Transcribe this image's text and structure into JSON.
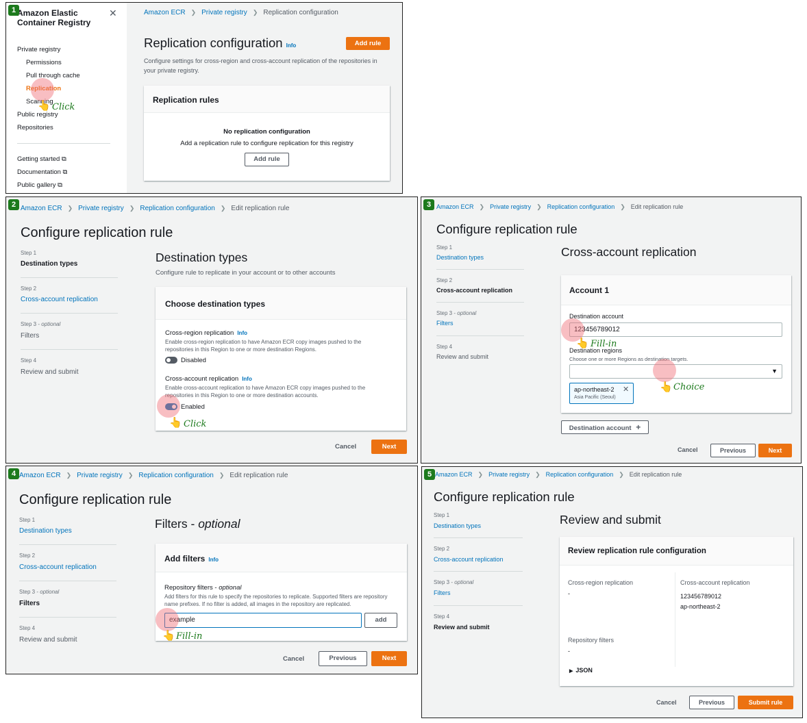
{
  "step_numbers": [
    "1",
    "2",
    "3",
    "4",
    "5"
  ],
  "actions": {
    "click": "Click",
    "fill_in": "Fill-in",
    "choice": "Choice"
  },
  "p1": {
    "sidebar_title": "Amazon Elastic Container Registry",
    "close_icon": "close-icon",
    "nav": {
      "private_registry": "Private registry",
      "permissions": "Permissions",
      "pull_through_cache": "Pull through cache",
      "replication": "Replication",
      "scanning": "Scanning",
      "public_registry": "Public registry",
      "repositories": "Repositories",
      "getting_started": "Getting started",
      "documentation": "Documentation",
      "public_gallery": "Public gallery"
    },
    "crumbs": [
      "Amazon ECR",
      "Private registry",
      "Replication configuration"
    ],
    "title": "Replication configuration",
    "info": "Info",
    "add_rule_btn": "Add rule",
    "description": "Configure settings for cross-region and cross-account replication of the repositories in your private registry.",
    "card_title": "Replication rules",
    "empty_title": "No replication configuration",
    "empty_desc": "Add a replication rule to configure replication for this registry",
    "empty_btn": "Add rule"
  },
  "wizard": {
    "crumbs": [
      "Amazon ECR",
      "Private registry",
      "Replication configuration",
      "Edit replication rule"
    ],
    "title": "Configure replication rule",
    "steps": [
      {
        "label": "Step 1",
        "name": "Destination types"
      },
      {
        "label": "Step 2",
        "name": "Cross-account replication"
      },
      {
        "label": "Step 3",
        "optional": "optional",
        "name": "Filters"
      },
      {
        "label": "Step 4",
        "name": "Review and submit"
      }
    ],
    "cancel": "Cancel",
    "previous": "Previous",
    "next": "Next",
    "submit": "Submit rule"
  },
  "p2": {
    "section_title": "Destination types",
    "section_desc": "Configure rule to replicate in your account or to other accounts",
    "card_title": "Choose destination types",
    "cross_region": {
      "label": "Cross-region replication",
      "info": "Info",
      "desc": "Enable cross-region replication to have Amazon ECR copy images pushed to the repositories in this Region to one or more destination Regions.",
      "state": "Disabled"
    },
    "cross_account": {
      "label": "Cross-account replication",
      "info": "Info",
      "desc": "Enable cross-account replication to have Amazon ECR copy images pushed to the repositories in this Region to one or more destination accounts.",
      "state": "Enabled"
    }
  },
  "p3": {
    "section_title": "Cross-account replication",
    "card_title": "Account 1",
    "dest_account_label": "Destination account",
    "dest_account_value": "123456789012",
    "dest_regions_label": "Destination regions",
    "dest_regions_desc": "Choose one or more Regions as destination targets.",
    "token_region": "ap-northeast-2",
    "token_sub": "Asia Pacific (Seoul)",
    "add_dest_btn": "Destination account"
  },
  "p4": {
    "section_title": "Filters - ",
    "section_title_italic": "optional",
    "card_title": "Add filters",
    "info": "Info",
    "filters_label": "Repository filters - ",
    "filters_label_italic": "optional",
    "filters_desc": "Add filters for this rule to specify the repositories to replicate. Supported filters are repository name prefixes. If no filter is added, all images in the repository are replicated.",
    "filter_value": "example",
    "add_btn": "add"
  },
  "p5": {
    "section_title": "Review and submit",
    "card_title": "Review replication rule configuration",
    "cross_region_label": "Cross-region replication",
    "cross_region_value": "-",
    "cross_account_label": "Cross-account replication",
    "cross_account_values": [
      "123456789012",
      "ap-northeast-2"
    ],
    "repo_filters_label": "Repository filters",
    "repo_filters_value": "-",
    "json_label": "JSON"
  }
}
